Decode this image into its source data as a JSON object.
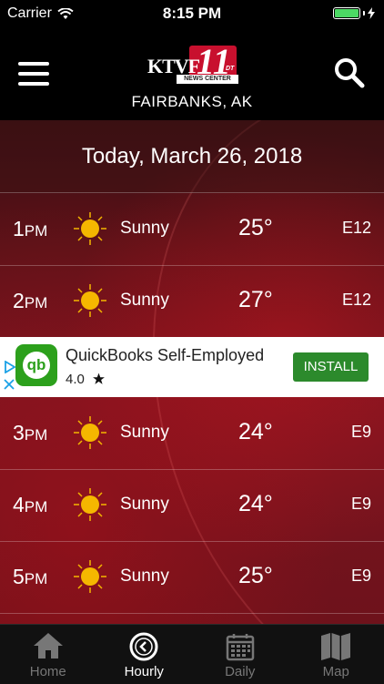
{
  "status_bar": {
    "carrier": "Carrier",
    "time": "8:15 PM"
  },
  "header": {
    "logo_text": "KTVF",
    "logo_number": "11",
    "logo_dt": "DT",
    "logo_news": "NEWS CENTER",
    "location": "FAIRBANKS, AK"
  },
  "date_label": "Today, March 26, 2018",
  "hourly": [
    {
      "hour": "1",
      "ampm": "PM",
      "condition": "Sunny",
      "temp": "25°",
      "wind": "E12"
    },
    {
      "hour": "2",
      "ampm": "PM",
      "condition": "Sunny",
      "temp": "27°",
      "wind": "E12"
    },
    {
      "hour": "3",
      "ampm": "PM",
      "condition": "Sunny",
      "temp": "24°",
      "wind": "E9"
    },
    {
      "hour": "4",
      "ampm": "PM",
      "condition": "Sunny",
      "temp": "24°",
      "wind": "E9"
    },
    {
      "hour": "5",
      "ampm": "PM",
      "condition": "Sunny",
      "temp": "25°",
      "wind": "E9"
    }
  ],
  "ad": {
    "icon_text": "qb",
    "title": "QuickBooks Self-Employed",
    "rating": "4.0",
    "install_label": "INSTALL"
  },
  "tabs": [
    {
      "label": "Home",
      "icon": "home-icon"
    },
    {
      "label": "Hourly",
      "icon": "clock-icon"
    },
    {
      "label": "Daily",
      "icon": "calendar-icon"
    },
    {
      "label": "Map",
      "icon": "map-icon"
    }
  ],
  "colors": {
    "accent_red": "#c8102e",
    "sun": "#f5b700",
    "install_green": "#2c8a2c",
    "battery_green": "#4cd964"
  }
}
